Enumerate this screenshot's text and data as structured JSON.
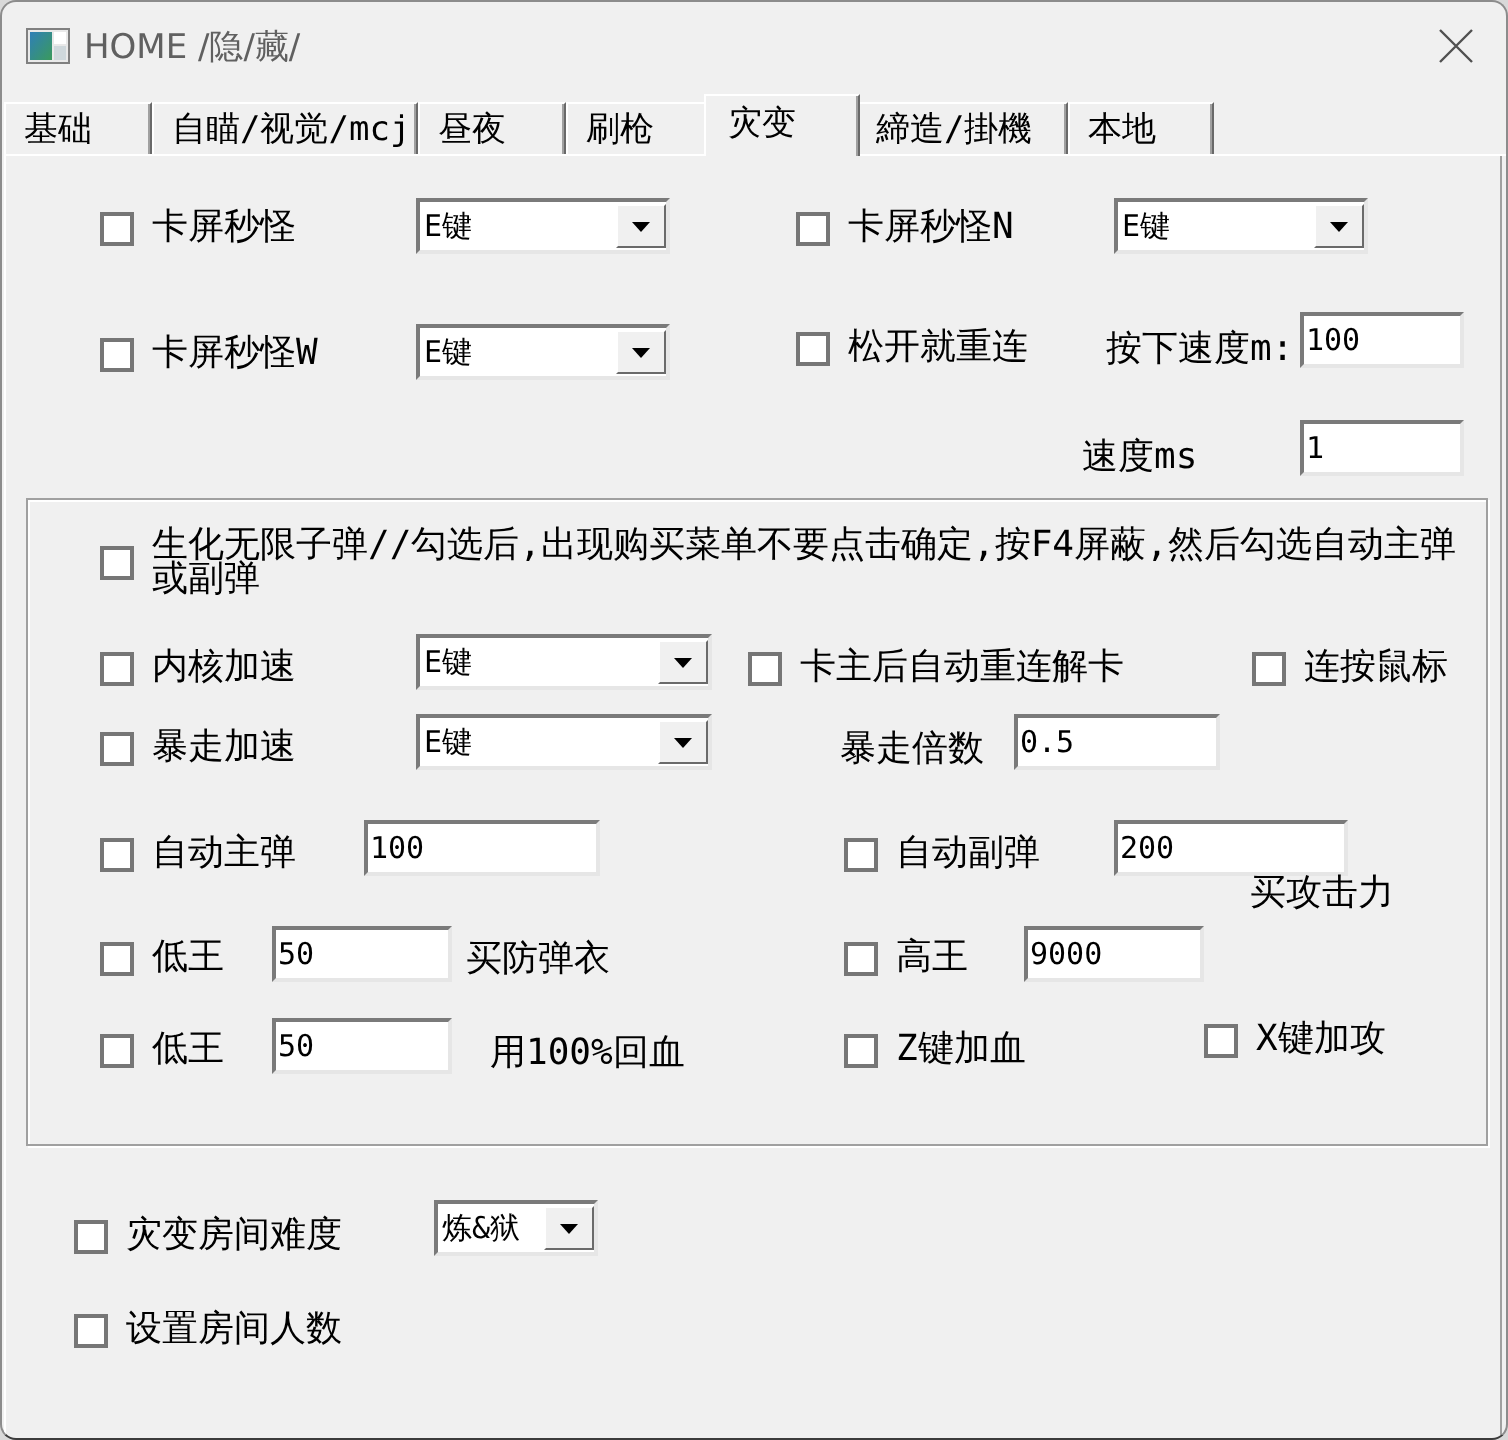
{
  "window": {
    "title": "HOME /隐/藏/"
  },
  "tabs": [
    {
      "label": "基础",
      "selected": false
    },
    {
      "label": "自瞄/视觉/mcj",
      "selected": false
    },
    {
      "label": "昼夜",
      "selected": false
    },
    {
      "label": "刷枪",
      "selected": false
    },
    {
      "label": "灾变",
      "selected": true
    },
    {
      "label": "締造/掛機",
      "selected": false
    },
    {
      "label": "本地",
      "selected": false
    }
  ],
  "top_rows": [
    [
      {
        "kind": "checkbox",
        "label": "卡屏秒怪",
        "checked": false
      },
      {
        "kind": "combobox",
        "value": "E键"
      },
      {
        "kind": "checkbox",
        "label": "卡屏秒怪N",
        "checked": false
      },
      {
        "kind": "combobox",
        "value": "E键"
      }
    ],
    [
      {
        "kind": "checkbox",
        "label": "卡屏秒怪W",
        "checked": false
      },
      {
        "kind": "combobox",
        "value": "E键"
      },
      {
        "kind": "checkbox",
        "label": "松开就重连",
        "checked": false
      },
      {
        "kind": "label",
        "text": "按下速度m:"
      },
      {
        "kind": "field",
        "value": "100"
      }
    ],
    [
      {
        "kind": "label",
        "text": "速度ms"
      },
      {
        "kind": "field",
        "value": "1"
      }
    ]
  ],
  "group_box": {
    "rows": [
      [
        {
          "kind": "checkbox",
          "label": "生化无限子弹//勾选后,出现购买菜单不要点击确定,按F4屏蔽,然后勾选自动主弹或副弹",
          "checked": false
        }
      ],
      [
        {
          "kind": "checkbox",
          "label": "内核加速",
          "checked": false
        },
        {
          "kind": "combobox",
          "value": "E键"
        },
        {
          "kind": "checkbox",
          "label": "卡主后自动重连解卡",
          "checked": false
        },
        {
          "kind": "checkbox",
          "label": "连按鼠标",
          "checked": false
        }
      ],
      [
        {
          "kind": "checkbox",
          "label": "暴走加速",
          "checked": false
        },
        {
          "kind": "combobox",
          "value": "E键"
        },
        {
          "kind": "label",
          "text": "暴走倍数"
        },
        {
          "kind": "field",
          "value": "0.5"
        }
      ],
      [
        {
          "kind": "checkbox",
          "label": "自动主弹",
          "checked": false
        },
        {
          "kind": "field",
          "value": "100"
        },
        {
          "kind": "checkbox",
          "label": "自动副弹",
          "checked": false
        },
        {
          "kind": "field",
          "value": "200"
        }
      ],
      [
        {
          "kind": "label",
          "text": "买攻击力"
        }
      ],
      [
        {
          "kind": "checkbox",
          "label": "低王",
          "checked": false
        },
        {
          "kind": "field",
          "value": "50"
        },
        {
          "kind": "label",
          "text": "买防弹衣"
        },
        {
          "kind": "checkbox",
          "label": "高王",
          "checked": false
        },
        {
          "kind": "field",
          "value": "9000"
        }
      ],
      [
        {
          "kind": "checkbox",
          "label": "低王",
          "checked": false
        },
        {
          "kind": "field",
          "value": "50"
        },
        {
          "kind": "label",
          "text": "用100%回血"
        },
        {
          "kind": "checkbox",
          "label": "Z键加血",
          "checked": false
        },
        {
          "kind": "checkbox",
          "label": "X键加攻",
          "checked": false
        }
      ]
    ]
  },
  "bottom_rows": [
    [
      {
        "kind": "checkbox",
        "label": "灾变房间难度",
        "checked": false
      },
      {
        "kind": "combobox",
        "value": "炼&狱"
      }
    ],
    [
      {
        "kind": "checkbox",
        "label": "设置房间人数",
        "checked": false
      }
    ]
  ]
}
